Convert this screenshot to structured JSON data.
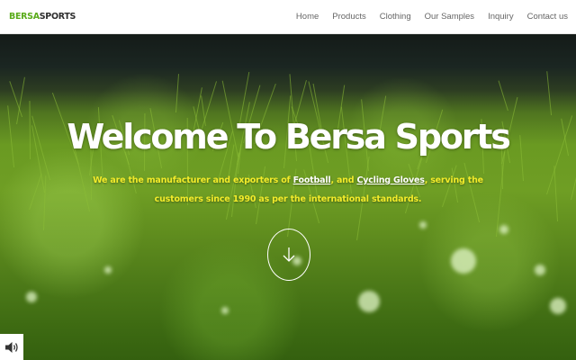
{
  "brand": {
    "part1": "BERSA",
    "part2": "SPORTS",
    "accent": "#5aab1a"
  },
  "nav": {
    "items": [
      {
        "label": "Home"
      },
      {
        "label": "Products"
      },
      {
        "label": "Clothing"
      },
      {
        "label": "Our Samples"
      },
      {
        "label": "Inquiry"
      },
      {
        "label": "Contact us"
      }
    ]
  },
  "hero": {
    "heading": "Welcome To Bersa Sports",
    "subtitle": {
      "part1": "We are the manufacturer and exporters of ",
      "link1": "Football",
      "part2": ", and ",
      "link2": "Cycling Gloves",
      "part3": ", serving the customers since 1990 as per the international standards."
    },
    "subtitle_color": "#f3ec2a",
    "scroll_icon": "arrow-down-icon"
  },
  "sound_icon": "speaker-icon"
}
